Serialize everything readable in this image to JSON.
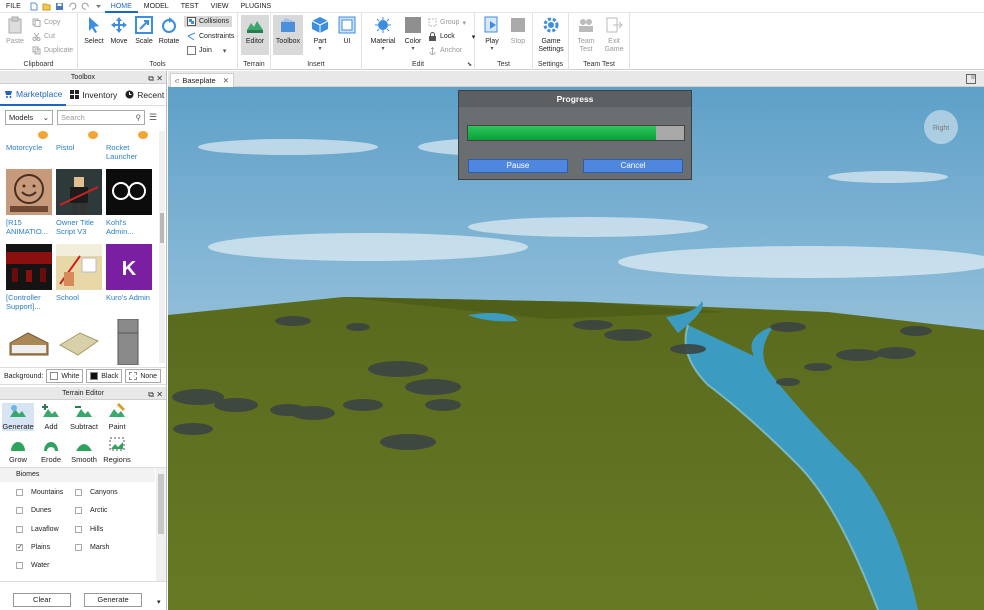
{
  "menubar": {
    "items": [
      "FILE",
      "HOME",
      "MODEL",
      "TEST",
      "VIEW",
      "PLUGINS"
    ],
    "active": "HOME"
  },
  "ribbon": {
    "clipboard": {
      "paste": "Paste",
      "copy": "Copy",
      "cut": "Cut",
      "duplicate": "Duplicate",
      "group_name": "Clipboard"
    },
    "tools": {
      "select": "Select",
      "move": "Move",
      "scale": "Scale",
      "rotate": "Rotate",
      "collisions": "Collisions",
      "constraints": "Constraints",
      "join": "Join",
      "group_name": "Tools"
    },
    "terrain": {
      "editor": "Editor",
      "group_name": "Terrain"
    },
    "insert": {
      "toolbox": "Toolbox",
      "part": "Part",
      "ui": "UI",
      "group_name": "Insert"
    },
    "edit": {
      "material": "Material",
      "color": "Color",
      "group": "Group",
      "lock": "Lock",
      "anchor": "Anchor",
      "group_name": "Edit"
    },
    "test": {
      "play": "Play",
      "stop": "Stop",
      "group_name": "Test"
    },
    "settings": {
      "game_settings": "Game Settings",
      "group_name": "Settings"
    },
    "team_test": {
      "team_test": "Team Test",
      "exit_game": "Exit Game",
      "group_name": "Team Test"
    }
  },
  "toolbox": {
    "title": "Toolbox",
    "tabs": [
      "Marketplace",
      "Inventory",
      "Recent"
    ],
    "filter_value": "Models",
    "search_placeholder": "Search",
    "items": [
      {
        "label": "Motorcycle"
      },
      {
        "label": "Pistol"
      },
      {
        "label": "Rocket Launcher"
      },
      {
        "label": "[R15 ANIMATIO..."
      },
      {
        "label": "Owner Title Script V3"
      },
      {
        "label": "Kohl's Admin..."
      },
      {
        "label": "[Controller Support]..."
      },
      {
        "label": "School"
      },
      {
        "label": "Kuro's Admin"
      }
    ],
    "background_label": "Background:",
    "bg_options": [
      "White",
      "Black",
      "None"
    ]
  },
  "terrain_editor": {
    "title": "Terrain Editor",
    "tools": [
      "Generate",
      "Add",
      "Subtract",
      "Paint",
      "Grow",
      "Erode",
      "Smooth",
      "Regions"
    ],
    "biomes_label": "Biomes",
    "biomes": [
      {
        "name": "Mountains",
        "checked": false
      },
      {
        "name": "Canyons",
        "checked": false
      },
      {
        "name": "Dunes",
        "checked": false
      },
      {
        "name": "Arctic",
        "checked": false
      },
      {
        "name": "Lavaflow",
        "checked": false
      },
      {
        "name": "Hills",
        "checked": false
      },
      {
        "name": "Plains",
        "checked": true
      },
      {
        "name": "Marsh",
        "checked": false
      },
      {
        "name": "Water",
        "checked": false
      }
    ],
    "clear_label": "Clear",
    "generate_label": "Generate"
  },
  "document": {
    "tab": "Baseplate"
  },
  "progress_dialog": {
    "title": "Progress",
    "progress": 0.87,
    "pause_label": "Pause",
    "cancel_label": "Cancel"
  },
  "viewport": {
    "compass_label": "Right"
  },
  "colors": {
    "accent": "#1f66c1",
    "progress": "#14b04a",
    "dialog_button": "#4f86e0",
    "grass": "#5e6e1f",
    "water": "#3aa0c8"
  }
}
